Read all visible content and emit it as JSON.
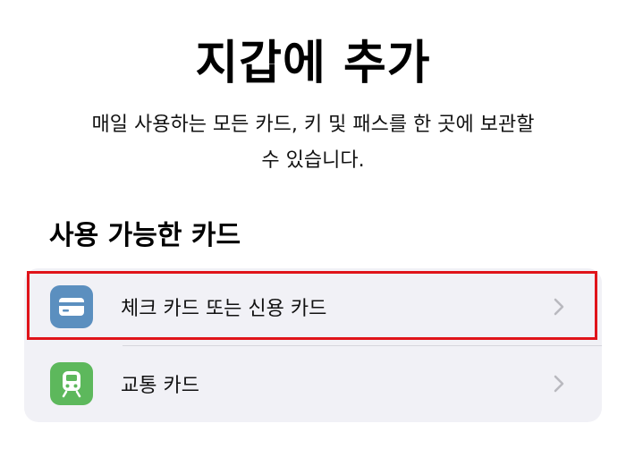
{
  "page": {
    "title": "지갑에 추가",
    "description_line1": "매일 사용하는 모든 카드, 키 및 패스를 한 곳에 보관할",
    "description_line2": "수 있습니다."
  },
  "section": {
    "heading": "사용 가능한 카드"
  },
  "options": [
    {
      "label": "체크 카드 또는 신용 카드",
      "icon": "credit-card-icon",
      "icon_bg": "#5b8fbf"
    },
    {
      "label": "교통 카드",
      "icon": "train-icon",
      "icon_bg": "#5db85c"
    }
  ],
  "colors": {
    "list_background": "#f1f1f6",
    "highlight": "#e0141a",
    "chevron": "#b9b9bf"
  }
}
